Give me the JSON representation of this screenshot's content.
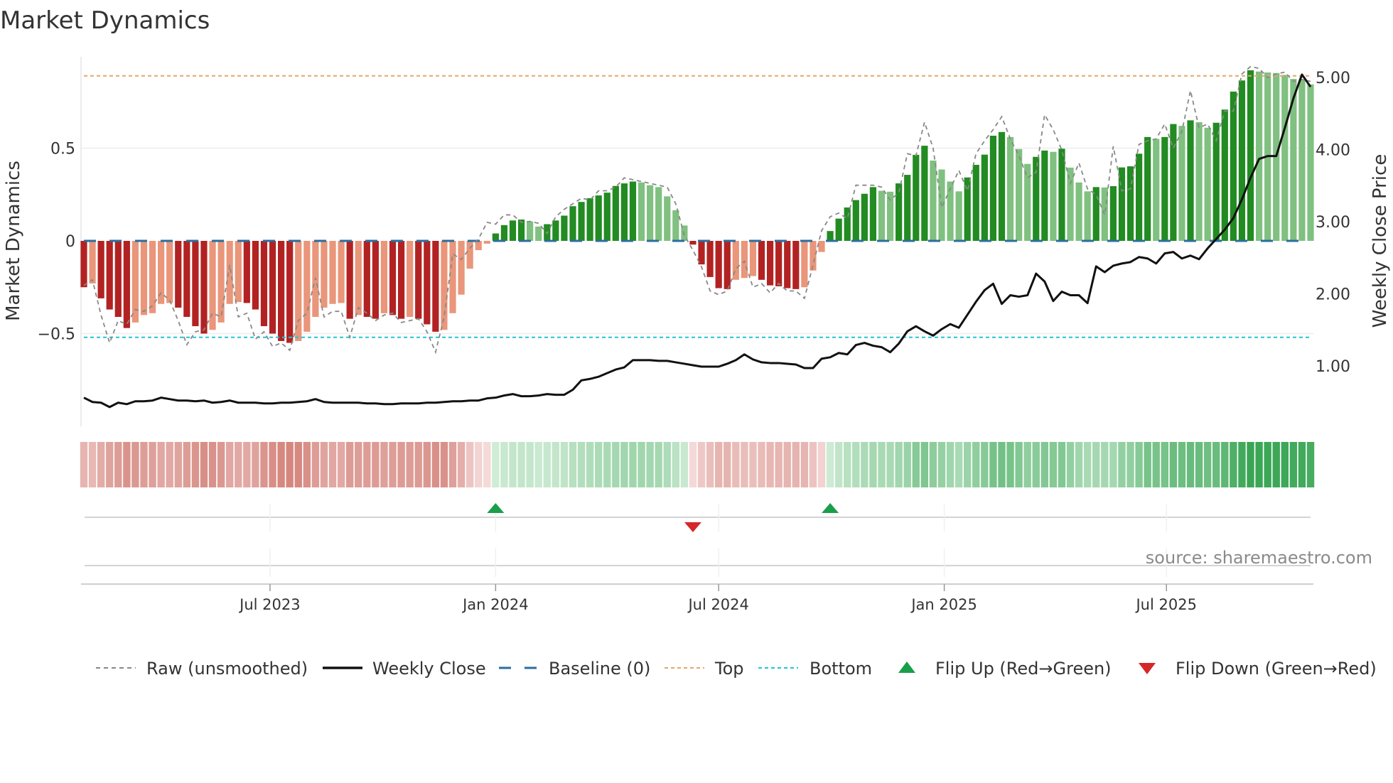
{
  "chart_data": {
    "type": "bar",
    "title": "Market Dynamics",
    "ylabel_left": "Market Dynamics",
    "ylabel_right": "Weekly Close Price",
    "left_ylim": [
      -0.92,
      1.0
    ],
    "right_ylim": [
      0.0,
      5.3
    ],
    "left_ticks": [
      {
        "v": 0.5,
        "label": "0.5"
      },
      {
        "v": 0,
        "label": "0"
      },
      {
        "v": -0.5,
        "label": "−0.5"
      }
    ],
    "right_ticks": [
      {
        "v": 5,
        "label": "5.00"
      },
      {
        "v": 4,
        "label": "4.00"
      },
      {
        "v": 3,
        "label": "3.00"
      },
      {
        "v": 2,
        "label": "2.00"
      },
      {
        "v": 1,
        "label": "1.00"
      }
    ],
    "x_unit": "week index",
    "x_ticks": [
      {
        "v": 21.7,
        "label": "Jul 2023"
      },
      {
        "v": 48.0,
        "label": "Jan 2024"
      },
      {
        "v": 74.0,
        "label": "Jul 2024"
      },
      {
        "v": 100.3,
        "label": "Jan 2025"
      },
      {
        "v": 126.2,
        "label": "Jul 2025"
      }
    ],
    "top_level": 0.89,
    "bottom_level": -0.52,
    "baseline": 0,
    "smoothed": [
      -0.25,
      -0.23,
      -0.31,
      -0.37,
      -0.41,
      -0.47,
      -0.44,
      -0.4,
      -0.39,
      -0.34,
      -0.335,
      -0.36,
      -0.41,
      -0.46,
      -0.5,
      -0.48,
      -0.44,
      -0.34,
      -0.33,
      -0.335,
      -0.37,
      -0.46,
      -0.5,
      -0.54,
      -0.55,
      -0.54,
      -0.49,
      -0.41,
      -0.36,
      -0.34,
      -0.335,
      -0.42,
      -0.4,
      -0.41,
      -0.42,
      -0.39,
      -0.4,
      -0.42,
      -0.41,
      -0.42,
      -0.45,
      -0.49,
      -0.48,
      -0.39,
      -0.29,
      -0.15,
      -0.05,
      -0.015,
      0.04,
      0.085,
      0.11,
      0.115,
      0.105,
      0.077,
      0.09,
      0.11,
      0.136,
      0.187,
      0.21,
      0.23,
      0.245,
      0.26,
      0.296,
      0.31,
      0.32,
      0.315,
      0.3,
      0.29,
      0.24,
      0.165,
      0.083,
      -0.02,
      -0.127,
      -0.195,
      -0.255,
      -0.26,
      -0.21,
      -0.2,
      -0.19,
      -0.21,
      -0.24,
      -0.245,
      -0.255,
      -0.26,
      -0.25,
      -0.16,
      -0.06,
      0.053,
      0.12,
      0.18,
      0.22,
      0.254,
      0.29,
      0.27,
      0.265,
      0.31,
      0.356,
      0.464,
      0.513,
      0.433,
      0.385,
      0.32,
      0.267,
      0.342,
      0.41,
      0.465,
      0.567,
      0.587,
      0.56,
      0.495,
      0.415,
      0.453,
      0.487,
      0.48,
      0.497,
      0.395,
      0.315,
      0.267,
      0.29,
      0.288,
      0.295,
      0.396,
      0.402,
      0.47,
      0.56,
      0.55,
      0.56,
      0.63,
      0.62,
      0.65,
      0.64,
      0.61,
      0.637,
      0.708,
      0.805,
      0.865,
      0.92,
      0.913,
      0.908,
      0.905,
      0.895,
      0.873,
      0.872,
      0.844
    ],
    "raw": [
      -0.24,
      -0.21,
      -0.4,
      -0.55,
      -0.43,
      -0.45,
      -0.37,
      -0.38,
      -0.35,
      -0.28,
      -0.32,
      -0.43,
      -0.56,
      -0.49,
      -0.48,
      -0.39,
      -0.41,
      -0.13,
      -0.41,
      -0.39,
      -0.53,
      -0.49,
      -0.57,
      -0.55,
      -0.59,
      -0.43,
      -0.39,
      -0.2,
      -0.41,
      -0.38,
      -0.38,
      -0.52,
      -0.36,
      -0.39,
      -0.43,
      -0.4,
      -0.39,
      -0.44,
      -0.43,
      -0.42,
      -0.49,
      -0.6,
      -0.41,
      -0.07,
      -0.1,
      -0.04,
      0.01,
      0.1,
      0.09,
      0.14,
      0.14,
      0.1,
      0.105,
      0.095,
      0.04,
      0.13,
      0.17,
      0.2,
      0.23,
      0.22,
      0.27,
      0.27,
      0.29,
      0.34,
      0.33,
      0.32,
      0.31,
      0.3,
      0.29,
      0.2,
      0.03,
      -0.05,
      -0.14,
      -0.27,
      -0.29,
      -0.27,
      -0.15,
      -0.11,
      -0.25,
      -0.23,
      -0.28,
      -0.23,
      -0.27,
      -0.27,
      -0.31,
      -0.13,
      0.055,
      0.13,
      0.15,
      0.12,
      0.3,
      0.3,
      0.3,
      0.29,
      0.22,
      0.26,
      0.47,
      0.46,
      0.64,
      0.5,
      0.18,
      0.28,
      0.38,
      0.27,
      0.47,
      0.54,
      0.6,
      0.67,
      0.55,
      0.46,
      0.34,
      0.37,
      0.68,
      0.6,
      0.49,
      0.31,
      0.42,
      0.28,
      0.25,
      0.14,
      0.51,
      0.27,
      0.28,
      0.52,
      0.54,
      0.55,
      0.63,
      0.5,
      0.59,
      0.81,
      0.61,
      0.63,
      0.54,
      0.7,
      0.7,
      0.9,
      0.94,
      0.93,
      0.88,
      0.9,
      0.91,
      0.86,
      0.87,
      0.86
    ],
    "weekly_close": [
      0.56,
      0.5,
      0.49,
      0.43,
      0.49,
      0.47,
      0.51,
      0.51,
      0.52,
      0.56,
      0.54,
      0.52,
      0.52,
      0.51,
      0.52,
      0.49,
      0.5,
      0.52,
      0.49,
      0.49,
      0.49,
      0.48,
      0.48,
      0.49,
      0.49,
      0.5,
      0.51,
      0.54,
      0.5,
      0.49,
      0.49,
      0.49,
      0.49,
      0.48,
      0.48,
      0.47,
      0.47,
      0.48,
      0.48,
      0.48,
      0.49,
      0.49,
      0.5,
      0.51,
      0.51,
      0.52,
      0.52,
      0.55,
      0.56,
      0.59,
      0.61,
      0.58,
      0.58,
      0.59,
      0.61,
      0.6,
      0.6,
      0.67,
      0.8,
      0.82,
      0.85,
      0.9,
      0.95,
      0.98,
      1.08,
      1.08,
      1.08,
      1.07,
      1.07,
      1.05,
      1.03,
      1.01,
      0.99,
      0.99,
      0.99,
      1.03,
      1.08,
      1.16,
      1.09,
      1.05,
      1.04,
      1.04,
      1.03,
      1.02,
      0.97,
      0.97,
      1.1,
      1.12,
      1.18,
      1.16,
      1.29,
      1.32,
      1.28,
      1.26,
      1.19,
      1.31,
      1.48,
      1.55,
      1.48,
      1.42,
      1.51,
      1.58,
      1.53,
      1.71,
      1.89,
      2.05,
      2.14,
      1.86,
      1.98,
      1.96,
      1.98,
      2.28,
      2.17,
      1.9,
      2.03,
      1.98,
      1.98,
      1.87,
      2.38,
      2.3,
      2.39,
      2.42,
      2.44,
      2.51,
      2.49,
      2.42,
      2.56,
      2.58,
      2.49,
      2.53,
      2.48,
      2.63,
      2.76,
      2.89,
      3.05,
      3.31,
      3.61,
      3.87,
      3.91,
      3.91,
      4.3,
      4.71,
      5.04,
      4.87
    ],
    "flips_up": [
      48,
      87
    ],
    "flips_down": [
      71
    ],
    "legend": {
      "position": "bottom",
      "items": [
        {
          "label": "Raw (unsmoothed)",
          "style": "dashed-gray"
        },
        {
          "label": "Weekly Close",
          "style": "solid-black"
        },
        {
          "label": "Baseline (0)",
          "style": "dashed-blue"
        },
        {
          "label": "Top",
          "style": "dotted-orange"
        },
        {
          "label": "Bottom",
          "style": "dotted-cyan"
        },
        {
          "label": "Flip Up (Red→Green)",
          "style": "triangle-up-green"
        },
        {
          "label": "Flip Down (Green→Red)",
          "style": "triangle-down-red"
        }
      ]
    },
    "colors": {
      "pos_strong": "#228b22",
      "pos_weak": "#80c080",
      "neg_strong": "#b22222",
      "neg_weak": "#e9967a",
      "raw": "#888888",
      "close": "#111111",
      "baseline": "#2a6e9e",
      "top": "#e3a868",
      "bottom": "#22c4d4",
      "flip_up": "#1a9e4a",
      "flip_down": "#d62728"
    },
    "source": "source: sharemaestro.com"
  }
}
